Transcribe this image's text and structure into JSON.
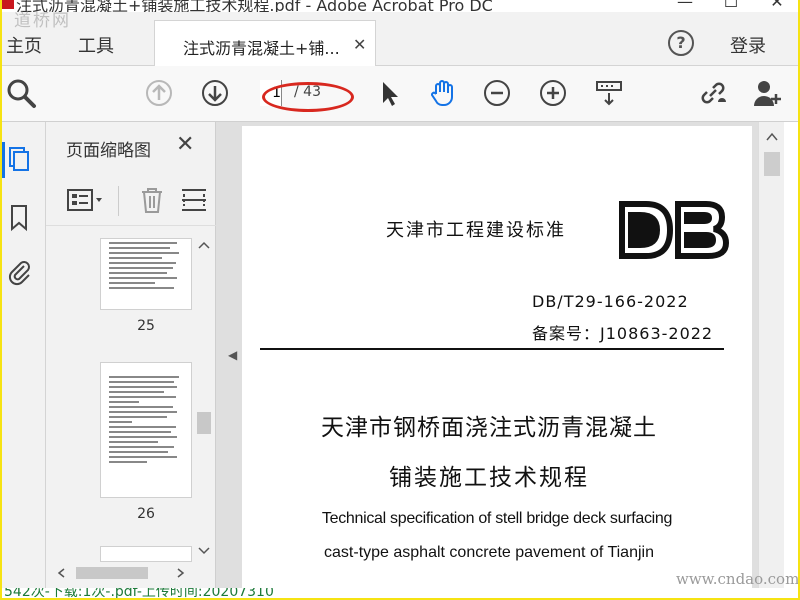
{
  "window": {
    "title": "注式沥青混凝土+铺装施工技术规程.pdf - Adobe Acrobat Pro DC",
    "site_logo": "道桥网"
  },
  "tabs": {
    "home": "主页",
    "tools": "工具",
    "document": "注式沥青混凝土+铺...",
    "login": "登录"
  },
  "toolbar": {
    "page_current": "1",
    "page_total": "/ 43",
    "highlight_color": "#d8281f"
  },
  "thumbnail_panel": {
    "title": "页面缩略图",
    "pages": [
      {
        "label": "25"
      },
      {
        "label": "26"
      }
    ]
  },
  "document": {
    "standard_label": "天津市工程建设标准",
    "logo_text": "DB",
    "standard_code": "DB/T29-166-2022",
    "record_no": "备案号：J10863-2022",
    "title_cn_line1": "天津市钢桥面浇注式沥青混凝土",
    "title_cn_line2": "铺装施工技术规程",
    "title_en_line1": "Technical specification of stell bridge deck surfacing",
    "title_en_line2": "cast-type asphalt concrete pavement of Tianjin"
  },
  "watermark": "www.cndao.com",
  "statusbar": {
    "text": "542次-下载:1次-.pdf-上传时间:20207310"
  },
  "colors": {
    "accent": "#1473e6",
    "frame": "#f6e313"
  }
}
